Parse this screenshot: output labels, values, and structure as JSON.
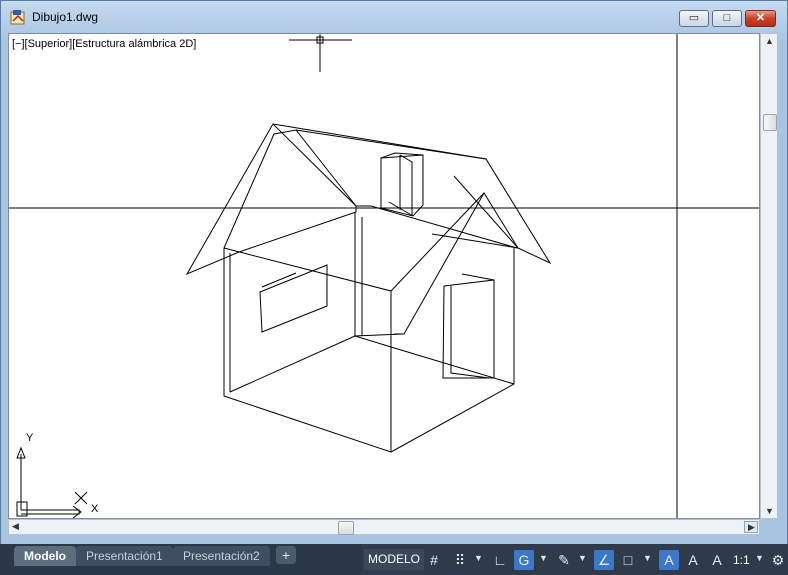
{
  "window": {
    "title": "Dibujo1.dwg",
    "minimize_glyph": "▭",
    "maximize_glyph": "□",
    "close_glyph": "✕"
  },
  "viewport": {
    "label": "[−][Superior][Estructura alámbrica 2D]",
    "ucs_y": "Y",
    "ucs_x": "X"
  },
  "tabs": [
    {
      "label": "Modelo",
      "active": true
    },
    {
      "label": "Presentación1",
      "active": false
    },
    {
      "label": "Presentación2",
      "active": false
    }
  ],
  "tab_add_glyph": "+",
  "status": {
    "model_label": "MODELO",
    "scale_label": "1:1",
    "icons": [
      {
        "name": "grid-icon",
        "glyph": "#"
      },
      {
        "name": "snap-icon",
        "glyph": "⠿"
      },
      {
        "name": "ortho-icon",
        "glyph": "∟"
      },
      {
        "name": "polar-icon",
        "glyph": "G"
      },
      {
        "name": "isodraft-icon",
        "glyph": "✎"
      },
      {
        "name": "dynamic-ucs-icon",
        "glyph": "∠"
      },
      {
        "name": "osnap-icon",
        "glyph": "□"
      },
      {
        "name": "annotation-visibility-icon",
        "glyph": "A"
      },
      {
        "name": "annotation-auto-scale-icon",
        "glyph": "A"
      },
      {
        "name": "annotation-scale-icon",
        "glyph": "A"
      },
      {
        "name": "gear-icon",
        "glyph": "⚙"
      }
    ]
  },
  "colors": {
    "statusbar_bg": "#2b3848",
    "active_toggle": "#3d78c8",
    "canvas_bg": "#ffffff"
  }
}
